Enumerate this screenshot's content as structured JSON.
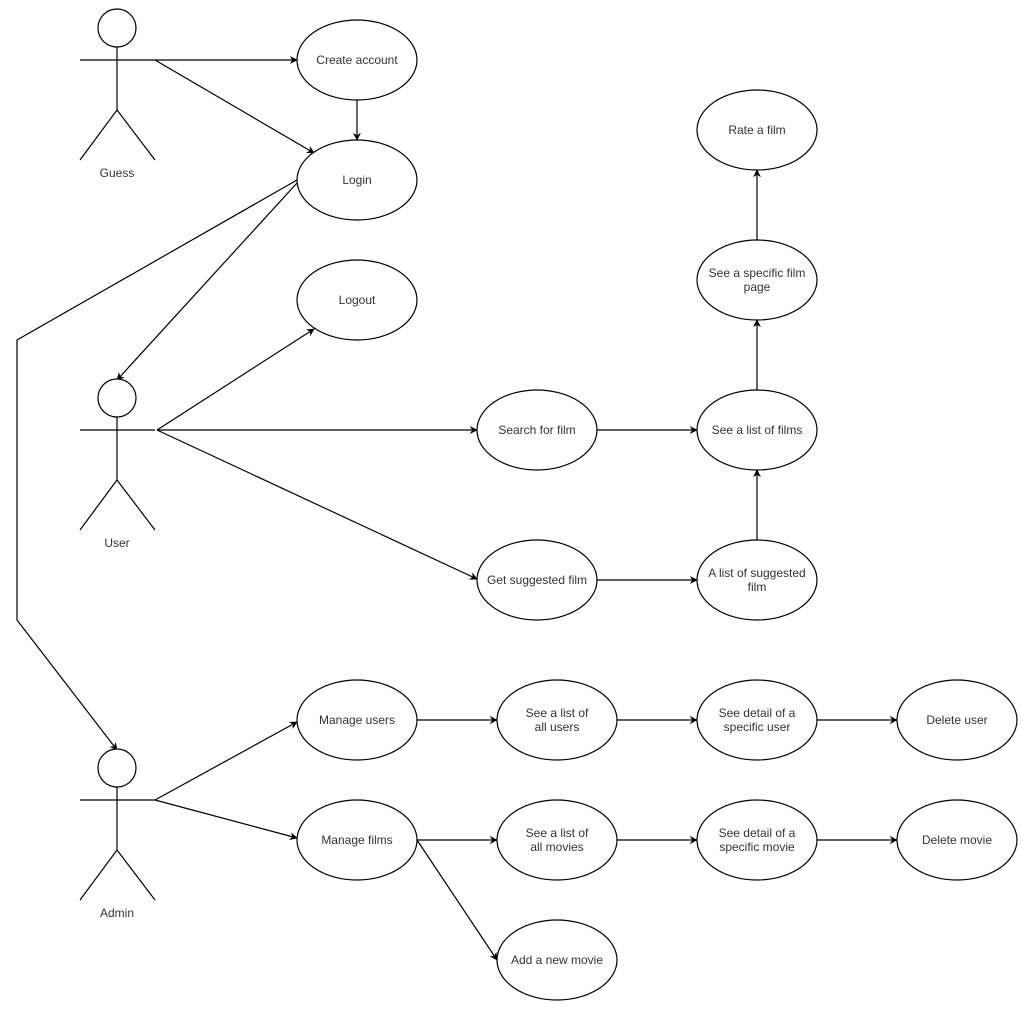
{
  "diagram": {
    "type": "use-case",
    "actors": [
      {
        "id": "guest",
        "label": "Guess"
      },
      {
        "id": "user",
        "label": "User"
      },
      {
        "id": "admin",
        "label": "Admin"
      }
    ],
    "use_cases": [
      {
        "id": "create_account",
        "lines": [
          "Create account"
        ]
      },
      {
        "id": "login",
        "lines": [
          "Login"
        ]
      },
      {
        "id": "logout",
        "lines": [
          "Logout"
        ]
      },
      {
        "id": "rate_film",
        "lines": [
          "Rate a film"
        ]
      },
      {
        "id": "specific_film_page",
        "lines": [
          "See a specific film",
          "page"
        ]
      },
      {
        "id": "search_film",
        "lines": [
          "Search for film"
        ]
      },
      {
        "id": "list_films",
        "lines": [
          "See a list of films"
        ]
      },
      {
        "id": "get_suggested",
        "lines": [
          "Get suggested film"
        ]
      },
      {
        "id": "list_suggested",
        "lines": [
          "A list of suggested",
          "film"
        ]
      },
      {
        "id": "manage_users",
        "lines": [
          "Manage users"
        ]
      },
      {
        "id": "list_users",
        "lines": [
          "See a list of",
          "all users"
        ]
      },
      {
        "id": "detail_user",
        "lines": [
          "See detail of a",
          "specific user"
        ]
      },
      {
        "id": "delete_user",
        "lines": [
          "Delete user"
        ]
      },
      {
        "id": "manage_films",
        "lines": [
          "Manage films"
        ]
      },
      {
        "id": "list_movies",
        "lines": [
          "See a list of",
          "all movies"
        ]
      },
      {
        "id": "detail_movie",
        "lines": [
          "See detail of a",
          "specific movie"
        ]
      },
      {
        "id": "delete_movie",
        "lines": [
          "Delete movie"
        ]
      },
      {
        "id": "add_movie",
        "lines": [
          "Add a new movie"
        ]
      }
    ],
    "edges": [
      {
        "from": "guest",
        "to": "create_account"
      },
      {
        "from": "guest",
        "to": "login"
      },
      {
        "from": "create_account",
        "to": "login"
      },
      {
        "from": "login",
        "to": "user"
      },
      {
        "from": "login",
        "to": "admin"
      },
      {
        "from": "user",
        "to": "logout"
      },
      {
        "from": "user",
        "to": "search_film"
      },
      {
        "from": "user",
        "to": "get_suggested"
      },
      {
        "from": "search_film",
        "to": "list_films"
      },
      {
        "from": "get_suggested",
        "to": "list_suggested"
      },
      {
        "from": "list_suggested",
        "to": "list_films"
      },
      {
        "from": "list_films",
        "to": "specific_film_page"
      },
      {
        "from": "specific_film_page",
        "to": "rate_film"
      },
      {
        "from": "admin",
        "to": "manage_users"
      },
      {
        "from": "admin",
        "to": "manage_films"
      },
      {
        "from": "manage_users",
        "to": "list_users"
      },
      {
        "from": "list_users",
        "to": "detail_user"
      },
      {
        "from": "detail_user",
        "to": "delete_user"
      },
      {
        "from": "manage_films",
        "to": "list_movies"
      },
      {
        "from": "list_movies",
        "to": "detail_movie"
      },
      {
        "from": "detail_movie",
        "to": "delete_movie"
      },
      {
        "from": "manage_films",
        "to": "add_movie"
      }
    ]
  }
}
